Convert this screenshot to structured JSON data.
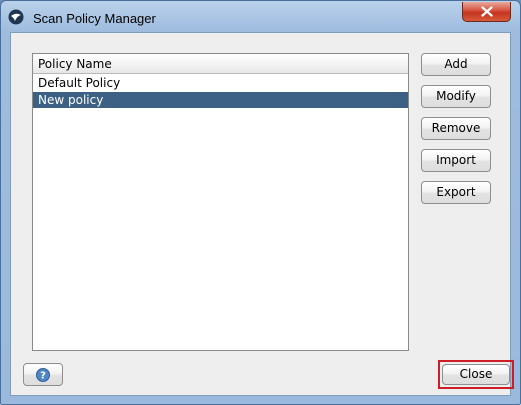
{
  "window": {
    "title": "Scan Policy Manager",
    "icon": "app-logo-icon",
    "close_icon": "close-icon"
  },
  "table": {
    "columns": [
      "Policy Name"
    ],
    "rows": [
      {
        "name": "Default Policy",
        "selected": false
      },
      {
        "name": "New policy",
        "selected": true
      }
    ]
  },
  "actions": {
    "add": "Add",
    "modify": "Modify",
    "remove": "Remove",
    "import": "Import",
    "export": "Export"
  },
  "footer": {
    "help_icon": "help-icon",
    "close": "Close"
  },
  "colors": {
    "selection": "#3d6185",
    "highlight_border": "#d01c24",
    "close_button_red": "#c4341f",
    "frame": "#9bb9dd"
  }
}
